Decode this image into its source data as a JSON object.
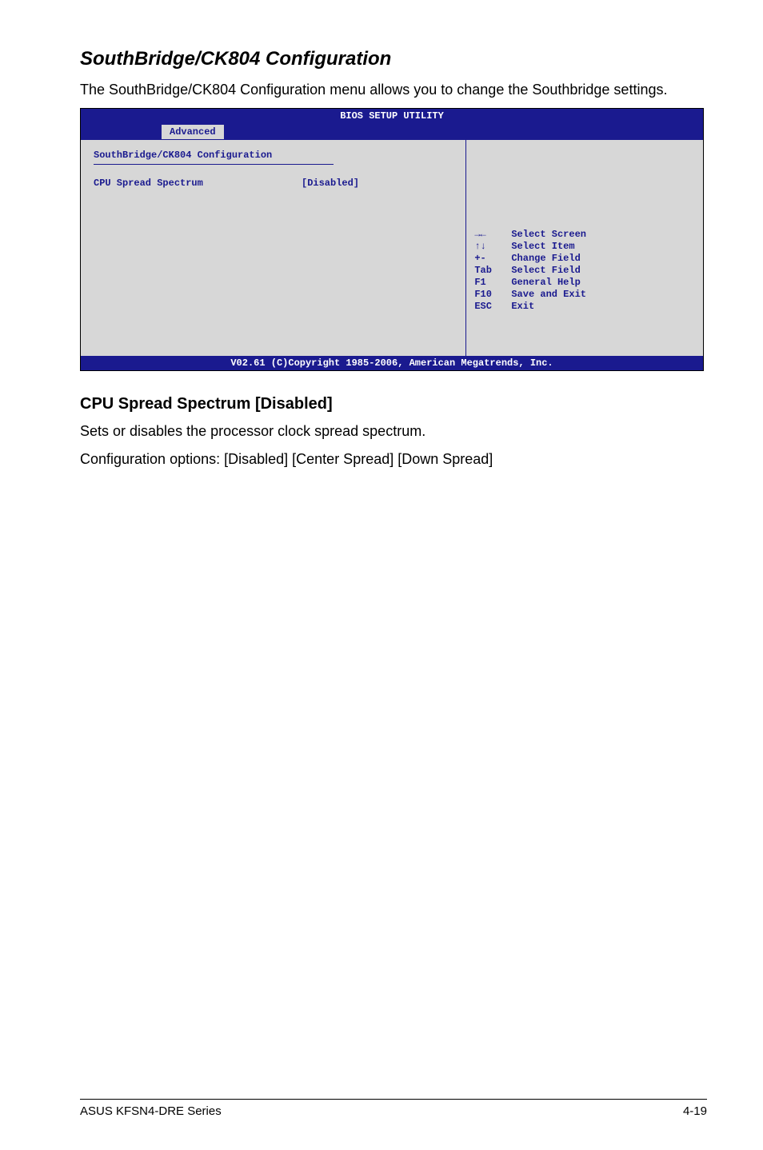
{
  "heading": "SouthBridge/CK804 Configuration",
  "intro": "The SouthBridge/CK804 Configuration menu allows you to change the Southbridge settings.",
  "bios": {
    "title": "BIOS SETUP UTILITY",
    "tab": "Advanced",
    "section_label": "SouthBridge/CK804 Configuration",
    "item_label": "CPU Spread Spectrum",
    "item_value": "[Disabled]",
    "nav": {
      "select_screen": {
        "key": "→←",
        "label": "Select Screen"
      },
      "select_item": {
        "key": "↑↓",
        "label": "Select Item"
      },
      "change_field": {
        "key": "+-",
        "label": "Change Field"
      },
      "select_field": {
        "key": "Tab",
        "label": "Select Field"
      },
      "general_help": {
        "key": "F1",
        "label": "General Help"
      },
      "save_exit": {
        "key": "F10",
        "label": "Save and Exit"
      },
      "exit": {
        "key": "ESC",
        "label": "Exit"
      }
    },
    "footer": "V02.61 (C)Copyright 1985-2006, American Megatrends, Inc."
  },
  "subheading": "CPU Spread Spectrum [Disabled]",
  "description1": "Sets or disables the processor clock spread spectrum.",
  "description2": "Configuration options: [Disabled] [Center Spread] [Down Spread]",
  "footer": {
    "left": "ASUS KFSN4-DRE Series",
    "right": "4-19"
  }
}
